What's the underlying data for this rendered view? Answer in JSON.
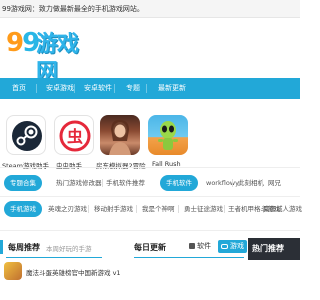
{
  "topbar": {
    "text": "99游戏网：致力做最新最全的手机游戏网站。"
  },
  "logo": {
    "digits": "99",
    "text": "游戏网"
  },
  "nav": {
    "items": [
      {
        "label": "首页"
      },
      {
        "label": "安卓游戏"
      },
      {
        "label": "安卓软件"
      },
      {
        "label": "专题"
      },
      {
        "label": "最新更新"
      }
    ]
  },
  "apps": [
    {
      "label": "Steam游戏助手",
      "icon": "steam-icon"
    },
    {
      "label": "虫虫助手",
      "icon": "chong-icon",
      "glyph": "虫"
    },
    {
      "label": "房东模拟器2冒险...",
      "icon": "woman-character-icon"
    },
    {
      "label": "Fall Rush",
      "icon": "fall-rush-alien-icon"
    }
  ],
  "rows": [
    {
      "badge": "专题合集",
      "items": [
        "热门游戏修改器",
        "手机软件推荐"
      ]
    },
    {
      "badge": "手机软件",
      "items": [
        "workflowy",
        "此刻相机",
        "网兄"
      ]
    },
    {
      "badge": "手机游戏",
      "items": [
        "英魂之刃游戏",
        "移动射手游戏",
        "我是个神啊",
        "勇士征途游戏",
        "王者机甲格斗游戏",
        "麋鹿城人游戏"
      ]
    }
  ],
  "bottom": {
    "weekly": {
      "title": "每周推荐",
      "sub": "本周好玩的手游",
      "first_item": "魔法斗蛋英雄榜官中国新游戏 v1"
    },
    "daily": {
      "title": "每日更新",
      "tab_software": "软件",
      "tab_game": "游戏",
      "software_icon": "software-icon"
    },
    "hot": {
      "title": "热门推荐"
    }
  },
  "colors": {
    "accent": "#22a8d8",
    "logo_orange": "#ff9b1a",
    "dark": "#2b2f36"
  }
}
